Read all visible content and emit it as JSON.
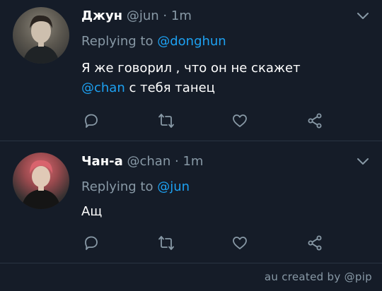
{
  "tweets": [
    {
      "name": "Джун",
      "handle": "@jun",
      "separator": "·",
      "time": "1m",
      "replying_prefix": "Replying to",
      "replying_to": "@donghun",
      "text_line1": "Я же говорил , что он не скажет",
      "text_mention": "@chan",
      "text_line2_rest": " с тебя танец",
      "icons": [
        "reply-icon",
        "retweet-icon",
        "like-icon",
        "share-icon"
      ]
    },
    {
      "name": "Чан-а",
      "handle": "@chan",
      "separator": "·",
      "time": "1m",
      "replying_prefix": "Replying to",
      "replying_to": "@jun",
      "text_line1": "Ащ",
      "icons": [
        "reply-icon",
        "retweet-icon",
        "like-icon",
        "share-icon"
      ]
    }
  ],
  "credit": "au created by @pip",
  "colors": {
    "background": "#151c28",
    "text": "#ffffff",
    "muted": "#8899a6",
    "accent": "#1da1f2",
    "divider": "#2a3442"
  }
}
